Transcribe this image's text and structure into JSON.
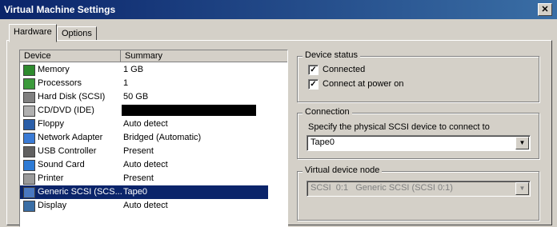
{
  "window": {
    "title": "Virtual Machine Settings",
    "close_glyph": "✕"
  },
  "tabs": [
    {
      "label": "Hardware"
    },
    {
      "label": "Options"
    }
  ],
  "device_list": {
    "headers": {
      "device": "Device",
      "summary": "Summary"
    },
    "rows": [
      {
        "device": "Memory",
        "summary": "1 GB",
        "icon": "memory-icon"
      },
      {
        "device": "Processors",
        "summary": "1",
        "icon": "processor-icon"
      },
      {
        "device": "Hard Disk (SCSI)",
        "summary": "50 GB",
        "icon": "hard-disk-icon"
      },
      {
        "device": "CD/DVD (IDE)",
        "summary": "",
        "icon": "cd-dvd-icon"
      },
      {
        "device": "Floppy",
        "summary": "Auto detect",
        "icon": "floppy-icon"
      },
      {
        "device": "Network Adapter",
        "summary": "Bridged (Automatic)",
        "icon": "network-adapter-icon"
      },
      {
        "device": "USB Controller",
        "summary": "Present",
        "icon": "usb-icon"
      },
      {
        "device": "Sound Card",
        "summary": "Auto detect",
        "icon": "sound-card-icon"
      },
      {
        "device": "Printer",
        "summary": "Present",
        "icon": "printer-icon"
      },
      {
        "device": "Generic SCSI (SCS...",
        "summary": "Tape0",
        "icon": "generic-scsi-icon",
        "selected": true
      },
      {
        "device": "Display",
        "summary": "Auto detect",
        "icon": "display-icon"
      }
    ]
  },
  "device_status": {
    "legend": "Device status",
    "connected": {
      "label": "Connected",
      "checked": true
    },
    "connect_at_power_on": {
      "label": "Connect at power on",
      "checked": true
    }
  },
  "connection": {
    "legend": "Connection",
    "instruction": "Specify the physical SCSI device to connect to",
    "selected_device": "Tape0"
  },
  "virtual_device_node": {
    "legend": "Virtual device node",
    "selected_node": "SCSI  0:1   Generic SCSI (SCSI 0:1)"
  },
  "colors": {
    "selection": "#0a246a",
    "title_start": "#0a246a",
    "title_end": "#3a6ea5",
    "face": "#d4d0c8"
  }
}
